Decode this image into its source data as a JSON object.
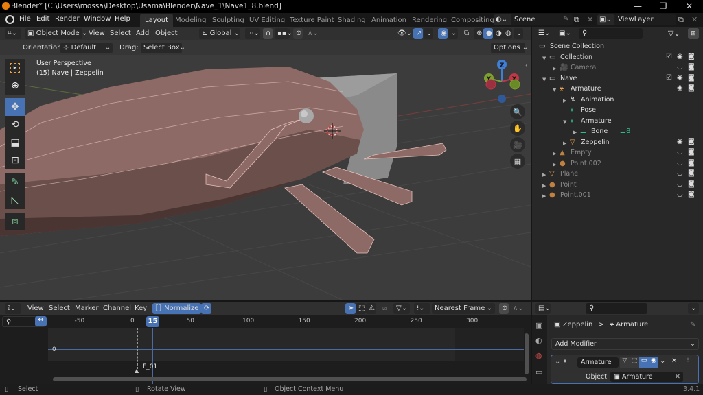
{
  "window": {
    "title": "Blender* [C:\\Users\\mossa\\Desktop\\Usama\\Blender\\Nave_1\\Nave1_8.blend]",
    "controls": {
      "minimize": "—",
      "maximize": "❐",
      "close": "✕"
    }
  },
  "menubar": {
    "items": [
      "File",
      "Edit",
      "Render",
      "Window",
      "Help"
    ],
    "workspaces": [
      "Layout",
      "Modeling",
      "Sculpting",
      "UV Editing",
      "Texture Paint",
      "Shading",
      "Animation",
      "Rendering",
      "Compositing"
    ],
    "active_workspace": "Layout",
    "scene": "Scene",
    "view_layer": "ViewLayer"
  },
  "viewport": {
    "header": {
      "mode": "Object Mode",
      "menus": [
        "View",
        "Select",
        "Add",
        "Object"
      ],
      "transform_orientation": "Global"
    },
    "subheader": {
      "orientation_label": "Orientation:",
      "orientation_value": "Default",
      "drag_label": "Drag:",
      "drag_value": "Select Box",
      "options_label": "Options"
    },
    "overlay_text": {
      "view_name": "User Perspective",
      "object_info": "(15) Nave | Zeppelin"
    },
    "tools": [
      "select-box",
      "cursor",
      "move",
      "rotate",
      "scale",
      "transform",
      "annotate",
      "measure",
      "add-cube"
    ],
    "active_tool": "move",
    "gizmo_axes": {
      "z": "Z",
      "y": "Y",
      "x": "X"
    },
    "colors": {
      "mesh": "#8f6a66",
      "accent": "#4772b3"
    }
  },
  "outliner": {
    "rows": [
      {
        "label": "Scene Collection",
        "depth": 0,
        "icon": "scene-collection"
      },
      {
        "label": "Collection",
        "depth": 1,
        "icon": "collection",
        "checkbox": true,
        "eye": true,
        "camera": true
      },
      {
        "label": "Camera",
        "depth": 2,
        "icon": "camera",
        "dim": true,
        "hidden": true,
        "camera": true
      },
      {
        "label": "Nave",
        "depth": 1,
        "icon": "collection",
        "checkbox": true,
        "eye": true,
        "camera": true
      },
      {
        "label": "Armature",
        "depth": 2,
        "icon": "armature",
        "eye": true,
        "camera": true
      },
      {
        "label": "Animation",
        "depth": 3,
        "icon": "animation"
      },
      {
        "label": "Pose",
        "depth": 3,
        "icon": "pose"
      },
      {
        "label": "Armature",
        "depth": 3,
        "icon": "armature-data"
      },
      {
        "label": "Bone",
        "depth": 4,
        "icon": "bone",
        "badge": "8"
      },
      {
        "label": "Zeppelin",
        "depth": 3,
        "icon": "mesh",
        "eye": true,
        "camera": true
      },
      {
        "label": "Empty",
        "depth": 2,
        "icon": "empty-image",
        "dim": true,
        "hidden": true,
        "camera": true
      },
      {
        "label": "Point.002",
        "depth": 2,
        "icon": "light",
        "dim": true,
        "hidden": true,
        "camera": true
      },
      {
        "label": "Plane",
        "depth": 1,
        "icon": "mesh",
        "dim": true,
        "hidden": true,
        "camera": true
      },
      {
        "label": "Point",
        "depth": 1,
        "icon": "light",
        "dim": true,
        "hidden": true,
        "camera": true
      },
      {
        "label": "Point.001",
        "depth": 1,
        "icon": "light",
        "dim": true,
        "hidden": true,
        "camera": true
      }
    ]
  },
  "timeline": {
    "menus": [
      "View",
      "Select",
      "Marker",
      "Channel",
      "Key"
    ],
    "normalize_label": "Normalize",
    "snap_mode": "Nearest Frame",
    "frame_ticks": [
      "-50",
      "0",
      "50",
      "100",
      "150",
      "200",
      "250",
      "300"
    ],
    "current_frame": "15",
    "zero_label": "0",
    "marker_label": "F_01"
  },
  "properties": {
    "breadcrumb": {
      "object": "Zeppelin",
      "sep": ">",
      "modifier": "Armature"
    },
    "add_modifier_label": "Add Modifier",
    "modifier": {
      "name": "Armature",
      "object_label": "Object",
      "object_value": "Armature"
    }
  },
  "statusbar": {
    "items": [
      "Select",
      "Rotate View",
      "Object Context Menu"
    ],
    "version": "3.4.1"
  }
}
